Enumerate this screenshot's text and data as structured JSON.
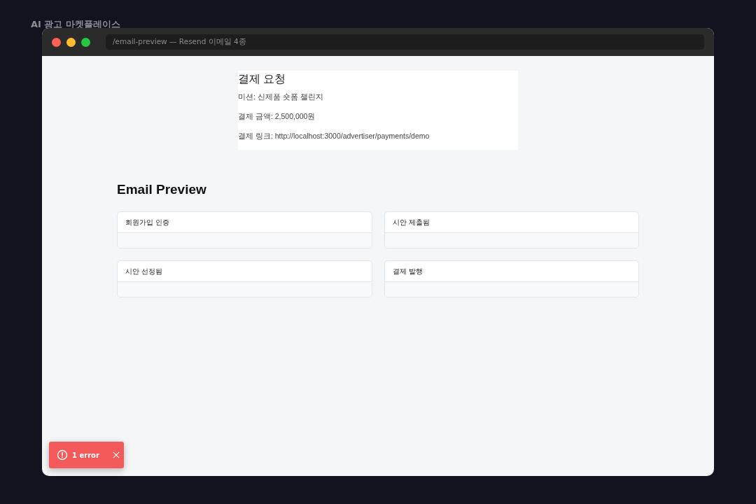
{
  "app_title": "AI 광고 마켓플레이스",
  "window": {
    "address": "/email-preview — Resend 이메일 4종"
  },
  "email": {
    "title": "결제 요청",
    "lines": [
      "미션: 신제품 숏폼 챌린지",
      "결제 금액: 2,500,000원",
      "결제 링크: http://localhost:3000/advertiser/payments/demo"
    ]
  },
  "preview": {
    "heading": "Email Preview",
    "cards": [
      {
        "title": "회원가입 인증"
      },
      {
        "title": "시안 제출됨"
      },
      {
        "title": "시안 선정됨"
      },
      {
        "title": "결제 발행"
      }
    ]
  },
  "toast": {
    "label": "1 error"
  }
}
